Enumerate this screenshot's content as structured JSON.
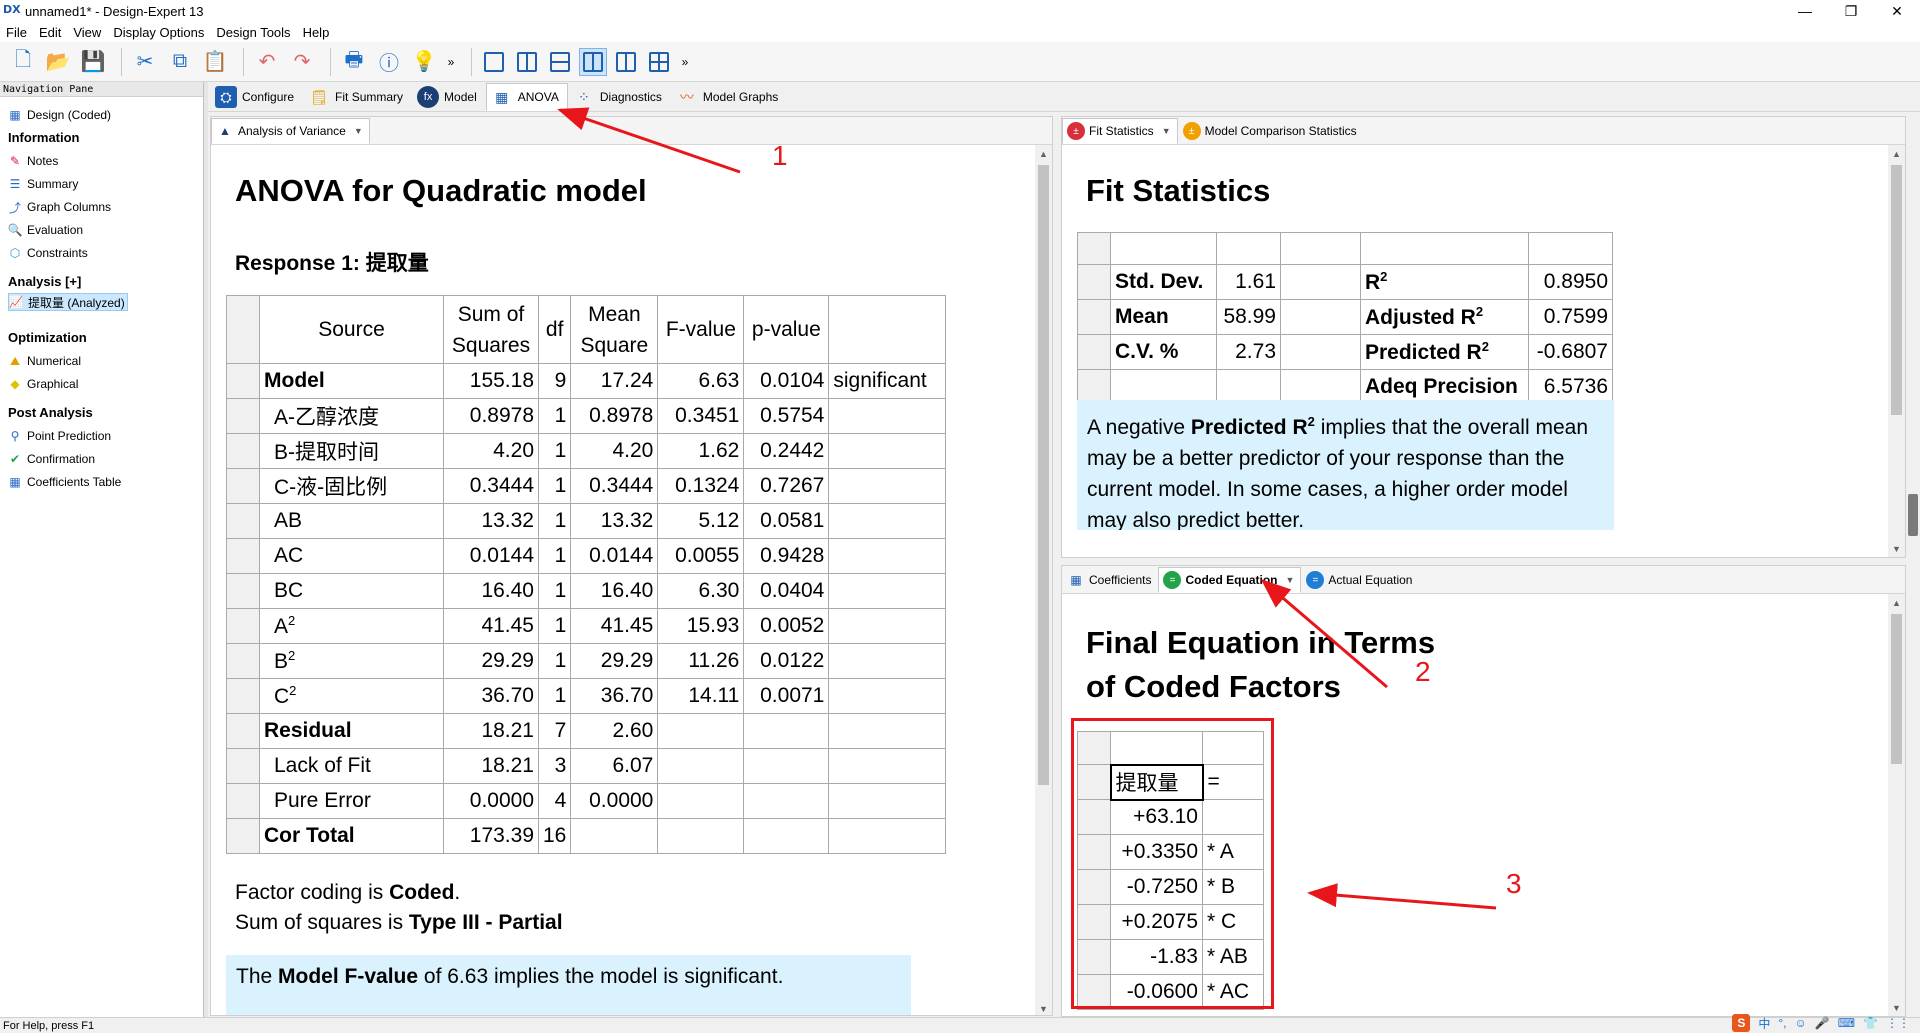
{
  "window": {
    "app_logo": "DX",
    "title": "unnamed1* - Design-Expert 13",
    "controls": [
      "—",
      "❐",
      "✕"
    ]
  },
  "menu": [
    "File",
    "Edit",
    "View",
    "Display Options",
    "Design Tools",
    "Help"
  ],
  "toolbar": {
    "buttons": [
      "new-file-icon",
      "open-folder-icon",
      "save-icon",
      "cut-icon",
      "copy-icon",
      "paste-icon",
      "undo-icon",
      "redo-icon",
      "print-icon",
      "help-icon",
      "tip-icon"
    ],
    "more": "»",
    "layout_buttons": [
      "layout-single-icon",
      "layout-two-columns-icon",
      "layout-two-rows-icon",
      "layout-three-pane-icon",
      "layout-three-pane-alt-icon",
      "layout-four-pane-icon"
    ]
  },
  "nav": {
    "title": "Navigation Pane",
    "design": "Design (Coded)",
    "information_header": "Information",
    "information": [
      "Notes",
      "Summary",
      "Graph Columns",
      "Evaluation",
      "Constraints"
    ],
    "analysis_header": "Analysis [+]",
    "analysis_item": "提取量 (Analyzed)",
    "optimization_header": "Optimization",
    "optimization": [
      "Numerical",
      "Graphical"
    ],
    "post_header": "Post Analysis",
    "post": [
      "Point Prediction",
      "Confirmation",
      "Coefficients Table"
    ]
  },
  "tabs": [
    "Configure",
    "Fit Summary",
    "Model",
    "ANOVA",
    "Diagnostics",
    "Model Graphs"
  ],
  "left": {
    "subtab": "Analysis of Variance",
    "title": "ANOVA for Quadratic model",
    "response": "Response 1: 提取量",
    "headers": {
      "source": "Source",
      "ss1": "Sum of",
      "ss2": "Squares",
      "df": "df",
      "ms1": "Mean",
      "ms2": "Square",
      "f": "F-value",
      "p": "p-value"
    },
    "rows": [
      {
        "source": "Model",
        "ss": "155.18",
        "df": "9",
        "ms": "17.24",
        "f": "6.63",
        "p": "0.0104",
        "note": "significant",
        "bold": true
      },
      {
        "source": "A-乙醇浓度",
        "ss": "0.8978",
        "df": "1",
        "ms": "0.8978",
        "f": "0.3451",
        "p": "0.5754",
        "note": ""
      },
      {
        "source": "B-提取时间",
        "ss": "4.20",
        "df": "1",
        "ms": "4.20",
        "f": "1.62",
        "p": "0.2442",
        "note": ""
      },
      {
        "source": "C-液-固比例",
        "ss": "0.3444",
        "df": "1",
        "ms": "0.3444",
        "f": "0.1324",
        "p": "0.7267",
        "note": ""
      },
      {
        "source": "AB",
        "ss": "13.32",
        "df": "1",
        "ms": "13.32",
        "f": "5.12",
        "p": "0.0581",
        "note": ""
      },
      {
        "source": "AC",
        "ss": "0.0144",
        "df": "1",
        "ms": "0.0144",
        "f": "0.0055",
        "p": "0.9428",
        "note": ""
      },
      {
        "source": "BC",
        "ss": "16.40",
        "df": "1",
        "ms": "16.40",
        "f": "6.30",
        "p": "0.0404",
        "note": ""
      },
      {
        "source": "A",
        "sup": "2",
        "ss": "41.45",
        "df": "1",
        "ms": "41.45",
        "f": "15.93",
        "p": "0.0052",
        "note": ""
      },
      {
        "source": "B",
        "sup": "2",
        "ss": "29.29",
        "df": "1",
        "ms": "29.29",
        "f": "11.26",
        "p": "0.0122",
        "note": ""
      },
      {
        "source": "C",
        "sup": "2",
        "ss": "36.70",
        "df": "1",
        "ms": "36.70",
        "f": "14.11",
        "p": "0.0071",
        "note": ""
      },
      {
        "source": "Residual",
        "ss": "18.21",
        "df": "7",
        "ms": "2.60",
        "f": "",
        "p": "",
        "note": "",
        "bold": true
      },
      {
        "source": "Lack of Fit",
        "ss": "18.21",
        "df": "3",
        "ms": "6.07",
        "f": "",
        "p": "",
        "note": ""
      },
      {
        "source": "Pure Error",
        "ss": "0.0000",
        "df": "4",
        "ms": "0.0000",
        "f": "",
        "p": "",
        "note": ""
      },
      {
        "source": "Cor Total",
        "ss": "173.39",
        "df": "16",
        "ms": "",
        "f": "",
        "p": "",
        "note": "",
        "bold": true
      }
    ],
    "coding_prefix": "Factor coding is ",
    "coding_value": "Coded",
    "coding_suffix": ".",
    "ss_prefix": "Sum of squares is ",
    "ss_value": "Type III - Partial",
    "note_prefix": "The ",
    "note_bold": "Model F-value",
    "note_rest": " of 6.63 implies the model is significant."
  },
  "right_top": {
    "tabs": [
      "Fit Statistics",
      "Model Comparison Statistics"
    ],
    "title": "Fit Statistics",
    "rows": [
      {
        "l1": "Std. Dev.",
        "v1": "1.61",
        "l2": "R",
        "sup2": "2",
        "v2": "0.8950"
      },
      {
        "l1": "Mean",
        "v1": "58.99",
        "l2": "Adjusted R",
        "sup2": "2",
        "v2": "0.7599"
      },
      {
        "l1": "C.V. %",
        "v1": "2.73",
        "l2": "Predicted R",
        "sup2": "2",
        "v2": "-0.6807"
      },
      {
        "l1": "",
        "v1": "",
        "l2": "Adeq Precision",
        "sup2": "",
        "v2": "6.5736"
      }
    ],
    "note_prefix": "A negative ",
    "note_bold": "Predicted R",
    "note_sup": "2",
    "note_rest": " implies that the overall mean may be a better predictor of your response than the current model. In some cases, a higher order model may also predict better."
  },
  "right_bot": {
    "tabs": [
      "Coefficients",
      "Coded Equation",
      "Actual Equation"
    ],
    "title_line1": "Final Equation in Terms",
    "title_line2": "of Coded Factors",
    "response": "提取量",
    "equals": "=",
    "terms": [
      {
        "coef": "+63.10",
        "term": ""
      },
      {
        "coef": "+0.3350",
        "term": "* A"
      },
      {
        "coef": "-0.7250",
        "term": "* B"
      },
      {
        "coef": "+0.2075",
        "term": "* C"
      },
      {
        "coef": "-1.83",
        "term": "* AB"
      },
      {
        "coef": "-0.0600",
        "term": "* AC"
      }
    ]
  },
  "annotations": {
    "label1": "1",
    "label2": "2",
    "label3": "3",
    "color": "#e8161b"
  },
  "status": {
    "help": "For Help, press F1",
    "ime": "S",
    "tray": [
      "中",
      "°,",
      "☺",
      "🎤",
      "⌨",
      "👕",
      "⋮⋮"
    ]
  }
}
